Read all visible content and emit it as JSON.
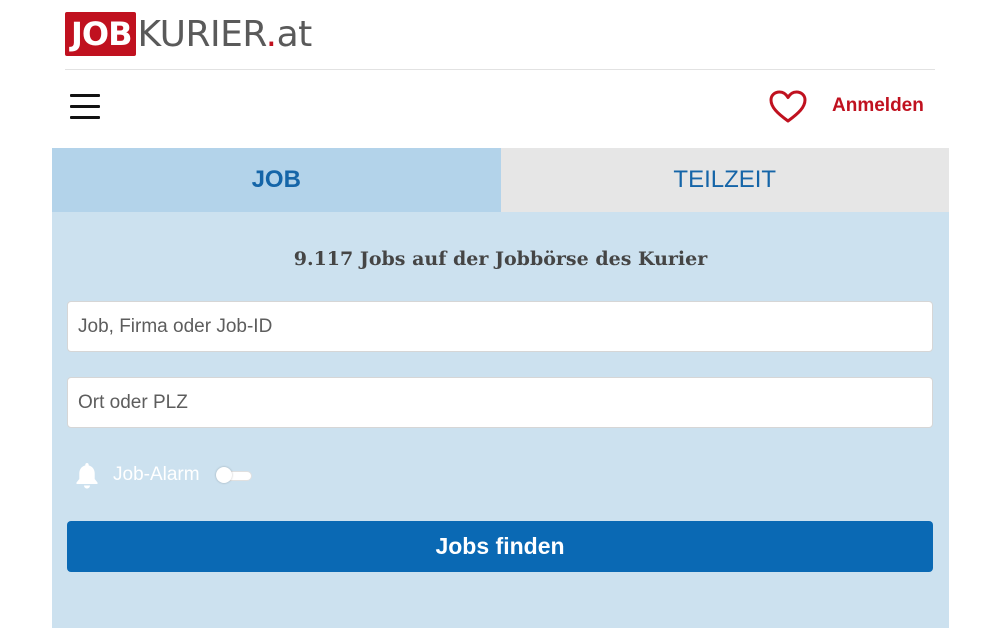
{
  "header": {
    "logo_box": "JOB",
    "logo_name": "KURIER",
    "logo_dot": ".",
    "logo_tld": "at",
    "login_label": "Anmelden"
  },
  "tabs": [
    {
      "label": "JOB",
      "active": true
    },
    {
      "label": "TEILZEIT",
      "active": false
    }
  ],
  "search": {
    "headline": "9.117 Jobs auf der Jobbörse des Kurier",
    "job_placeholder": "Job, Firma oder Job-ID",
    "location_placeholder": "Ort oder PLZ",
    "alarm_label": "Job-Alarm",
    "alarm_enabled": false,
    "submit_label": "Jobs finden"
  },
  "icons": {
    "menu": "hamburger-menu-icon",
    "favorites": "heart-icon",
    "alarm": "bell-icon"
  },
  "colors": {
    "brand_red": "#c0111f",
    "brand_blue": "#0a69b4",
    "tab_active_bg": "#b3d3ea",
    "tab_inactive_bg": "#e6e6e6",
    "panel_bg": "#cce1ef"
  }
}
